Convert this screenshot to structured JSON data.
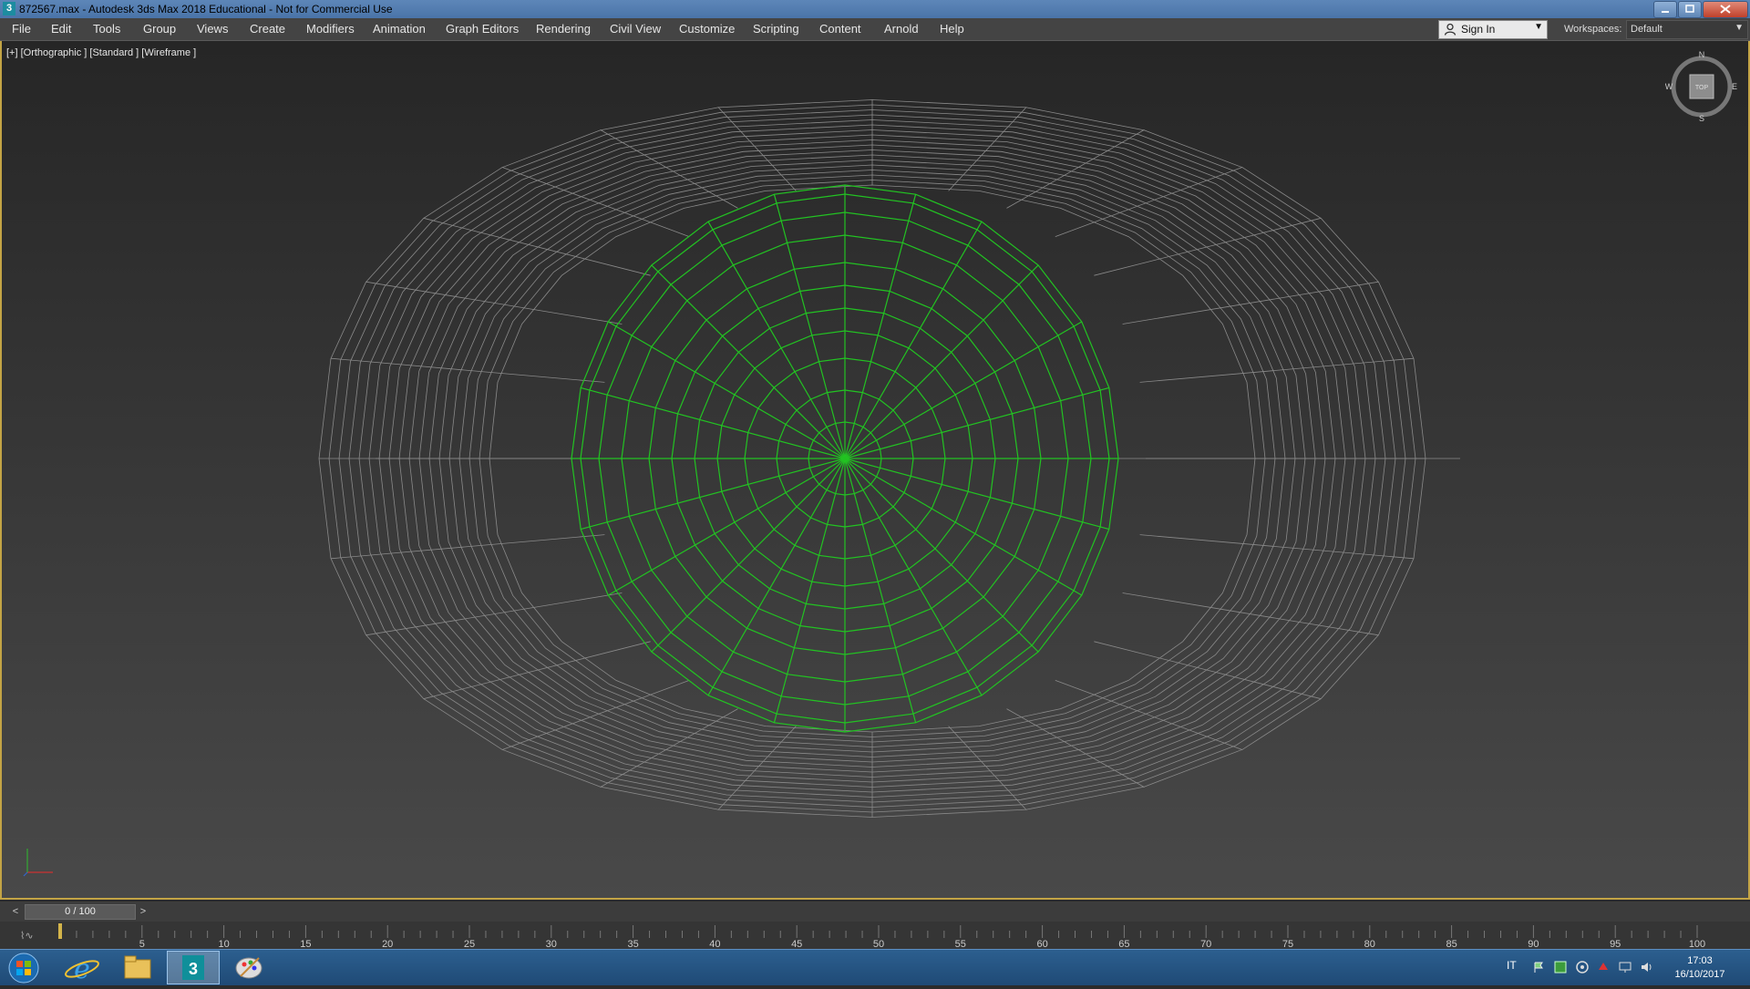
{
  "titlebar": {
    "app_icon": "3",
    "title": "872567.max - Autodesk 3ds Max 2018 Educational - Not for Commercial Use",
    "minimize_icon": "minimize-icon",
    "maximize_icon": "maximize-icon",
    "close_icon": "close-icon"
  },
  "menu": {
    "items": [
      "File",
      "Edit",
      "Tools",
      "Group",
      "Views",
      "Create",
      "Modifiers",
      "Animation",
      "Graph Editors",
      "Rendering",
      "Civil View",
      "Customize",
      "Scripting",
      "Content",
      "Arnold",
      "Help"
    ],
    "sign_in": "Sign In",
    "workspaces_label": "Workspaces:",
    "workspace_value": "Default"
  },
  "viewport": {
    "label": "[+] [Orthographic ] [Standard ] [Wireframe ]",
    "viewcube": {
      "top": "TOP",
      "north": "N",
      "south": "S",
      "east": "E",
      "west": "W"
    },
    "colors": {
      "wire_grey": "#8a8a8a",
      "wire_green": "#22c322",
      "border_active": "#c3a445"
    }
  },
  "timeline": {
    "frame_display": "0 / 100",
    "prev_label": "<",
    "next_label": ">",
    "current_frame": 0,
    "ticks": [
      "5",
      "10",
      "15",
      "20",
      "25",
      "30",
      "35",
      "40",
      "45",
      "50",
      "55",
      "60",
      "65",
      "70",
      "75",
      "80",
      "85",
      "90",
      "95",
      "100"
    ]
  },
  "taskbar": {
    "apps": [
      "start-orb-icon",
      "internet-explorer-icon",
      "file-explorer-icon",
      "3ds-max-icon",
      "paint-icon"
    ],
    "lang": "IT",
    "time": "17:03",
    "date": "16/10/2017"
  }
}
